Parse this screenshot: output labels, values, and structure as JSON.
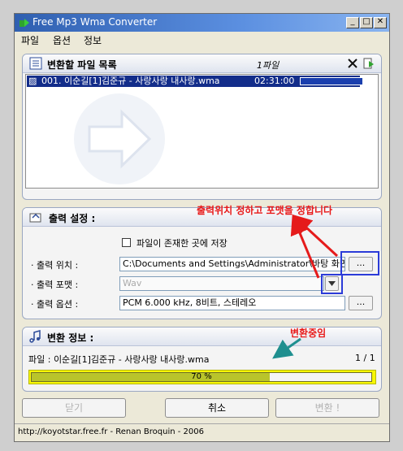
{
  "window": {
    "title": "Free Mp3 Wma Converter"
  },
  "menu": [
    "파일",
    "옵션",
    "정보"
  ],
  "file_list": {
    "title": "변환할 파일 목록",
    "count": "1파일",
    "rows": [
      {
        "index": "001.",
        "name": "이순길[1]김준규 - 사랑사랑 내사랑.wma",
        "duration": "02:31:00",
        "progress": 1.0
      }
    ]
  },
  "output": {
    "title": "출력 설정 :",
    "same_folder_label": "파일이 존재한 곳에 저장",
    "location_label": "· 출력 위치 :",
    "location_value": "C:\\Documents and Settings\\Administrator\\바탕 화면\\",
    "format_label": "· 출력 포맷 :",
    "format_value": "Wav",
    "options_label": "· 출력 옵션 :",
    "options_value": "PCM 6.000 kHz, 8비트, 스테레오",
    "browse_label": "...",
    "options_button": "..."
  },
  "info": {
    "title": "변환 정보 :",
    "file_text": "파일 : 이순길[1]김준규 - 사랑사랑 내사랑.wma",
    "count_text": "1 / 1",
    "progress_text": "70 %",
    "progress": 0.7
  },
  "buttons": {
    "close": "닫기",
    "cancel": "취소",
    "convert": "변환 !"
  },
  "status": "http://koyotstar.free.fr - Renan Broquin - 2006",
  "annotations": {
    "top": "출력위치 정하고 포맷을 정합니다",
    "mid": "변환중임"
  }
}
